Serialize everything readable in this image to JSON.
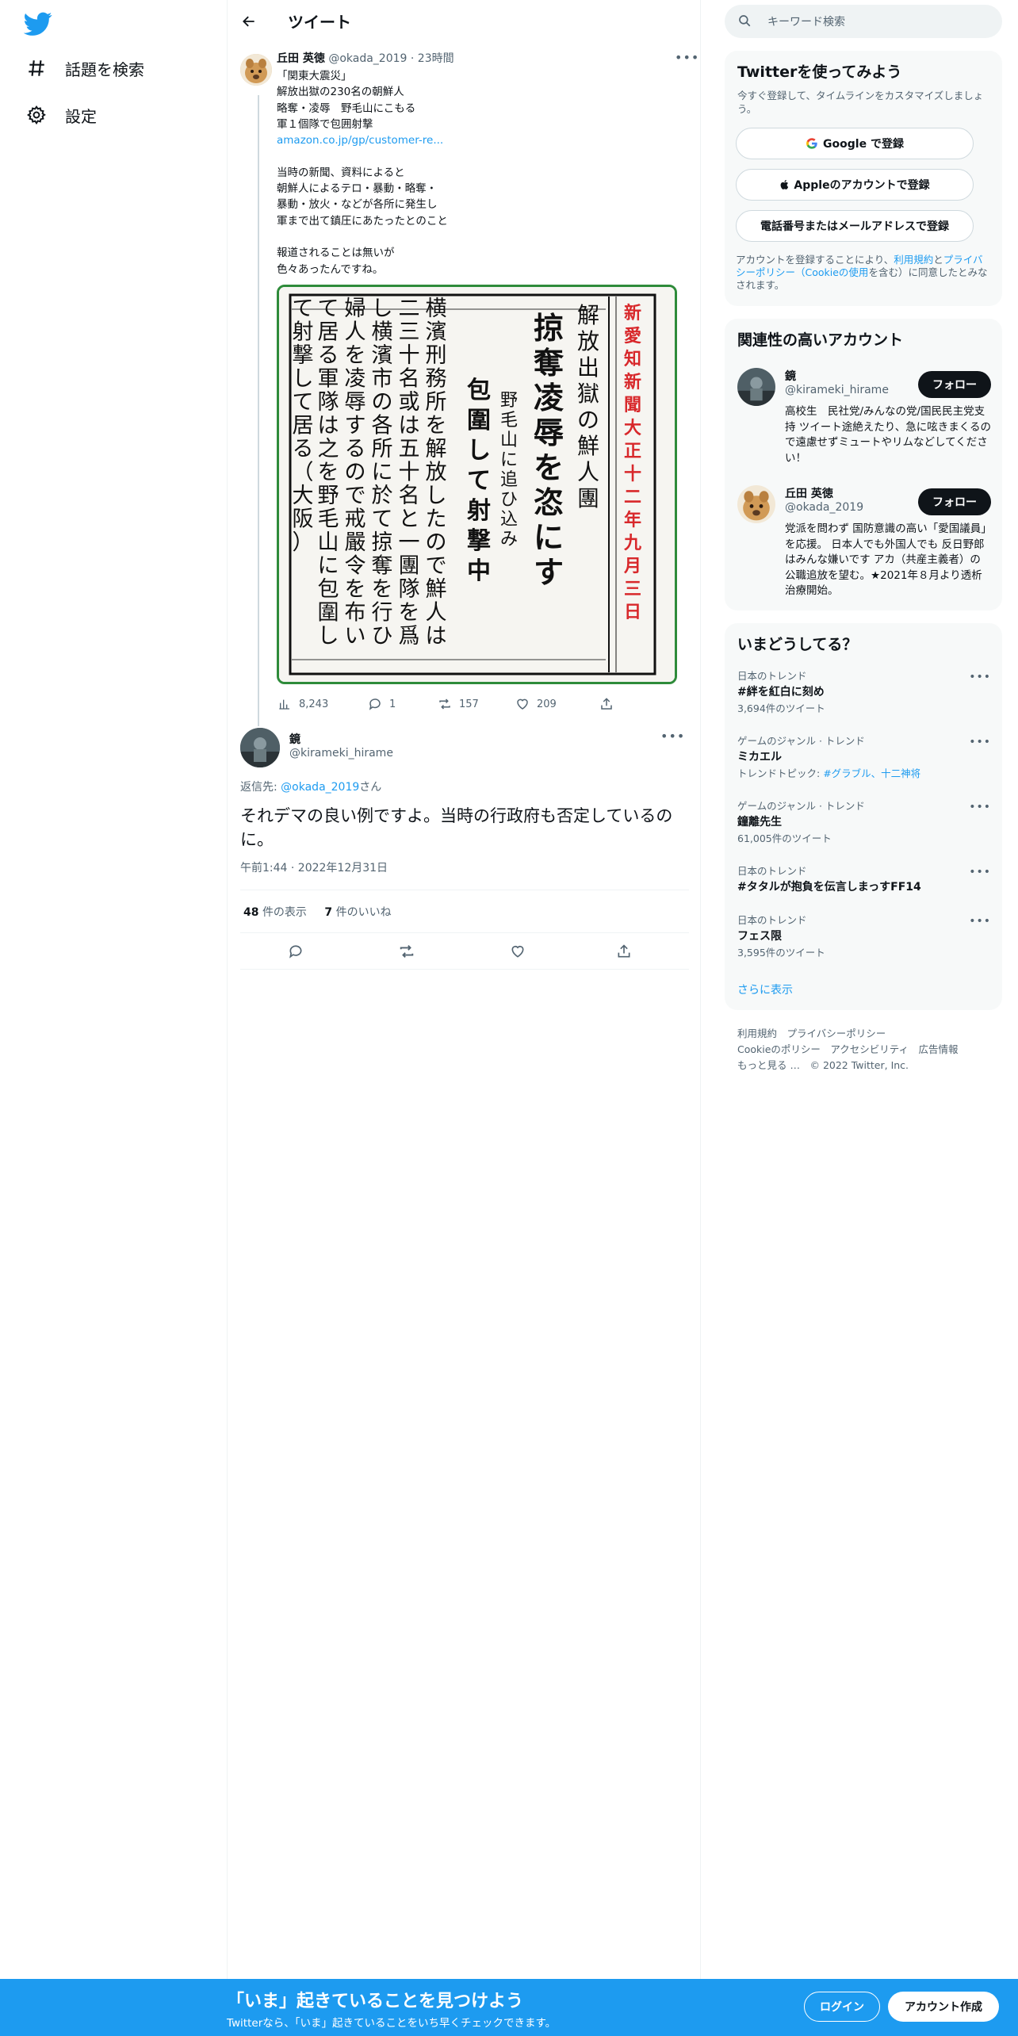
{
  "nav": {
    "explore_label": "話題を検索",
    "settings_label": "設定"
  },
  "header": {
    "title": "ツイート"
  },
  "tweet1": {
    "name": "丘田 英徳",
    "handle": "@okada_2019",
    "time": "23時間",
    "lines": [
      "「関東大震災」",
      "解放出獄の230名の朝鮮人",
      "略奪・凌辱　野毛山にこもる",
      "軍１個隊で包囲射撃"
    ],
    "link": "amazon.co.jp/gp/customer-re...",
    "lines2": [
      "当時の新聞、資料によると",
      "朝鮮人によるテロ・暴動・略奪・",
      "暴動・放火・などが各所に発生し",
      "軍まで出て鎮圧にあたったとのこと"
    ],
    "lines3": [
      "報道されることは無いが",
      "色々あったんですね。"
    ],
    "image": {
      "red_caption": "新愛知新聞 大正 十二年九月三日",
      "headline_small": "解放出獄の鮮人團",
      "headline_big": "掠奪凌辱を恣にす",
      "sub1": "野毛山に追ひ込み",
      "sub2": "包圍して射撃中",
      "body": [
        "横濱刑務所を解放したので鮮人は",
        "二三十名或は五十名と一團隊を爲",
        "し横濱市の各所に於て掠奪を行ひ",
        "婦人を凌辱するので戒嚴令を布い",
        "て居る軍隊は之を野毛山に包圍し",
        "て射撃して居る（大阪）"
      ]
    },
    "views": "8,243",
    "replies": "1",
    "retweets": "157",
    "likes": "209"
  },
  "tweet2": {
    "name": "鏡",
    "handle": "@kirameki_hirame",
    "reply_prefix": "返信先: ",
    "reply_to": "@okada_2019",
    "reply_suffix": "さん",
    "text": "それデマの良い例ですよ。当時の行政府も否定しているのに。",
    "timestamp": "午前1:44 · 2022年12月31日",
    "views_count": "48",
    "views_label": "件の表示",
    "likes_count": "7",
    "likes_label": "件のいいね"
  },
  "search": {
    "placeholder": "キーワード検索"
  },
  "signup_box": {
    "title": "Twitterを使ってみよう",
    "subtitle": "今すぐ登録して、タイムラインをカスタマイズしましょう。",
    "google": "Google で登録",
    "apple": "Appleのアカウントで登録",
    "phone": "電話番号またはメールアドレスで登録",
    "terms_1": "アカウントを登録することにより、",
    "terms_link1": "利用規約",
    "terms_2": "と",
    "terms_link2": "プライバシーポリシー（Cookieの使用",
    "terms_3": "を含む）に同意したとみなされます。"
  },
  "related": {
    "title": "関連性の高いアカウント",
    "accounts": [
      {
        "name": "鏡",
        "handle": "@kirameki_hirame",
        "bio": "高校生　民社党/みんなの党/国民民主党支持 ツイート途絶えたり、急に呟きまくるので遠慮せずミュートやリムなどしてください！",
        "follow": "フォロー"
      },
      {
        "name": "丘田 英徳",
        "handle": "@okada_2019",
        "bio": "党派を問わず 国防意識の高い「愛国議員」を応援。 日本人でも外国人でも 反日野郎はみんな嫌いです アカ（共産主義者）の公職追放を望む。★2021年８月より透析治療開始。",
        "follow": "フォロー"
      }
    ]
  },
  "trends": {
    "title": "いまどうしてる？",
    "items": [
      {
        "category": "日本のトレンド",
        "name": "#絆を紅白に刻め",
        "count": "3,694件のツイート"
      },
      {
        "category": "ゲームのジャンル · トレンド",
        "name": "ミカエル",
        "count_prefix": "トレンドトピック: ",
        "count_links": "#グラブル、十二神将"
      },
      {
        "category": "ゲームのジャンル · トレンド",
        "name": "鐘離先生",
        "count": "61,005件のツイート"
      },
      {
        "category": "日本のトレンド",
        "name": "#タタルが抱負を伝言しまっすFF14",
        "count": ""
      },
      {
        "category": "日本のトレンド",
        "name": "フェス限",
        "count": "3,595件のツイート"
      }
    ],
    "show_more": "さらに表示"
  },
  "footer": {
    "line1": "利用規約　プライバシーポリシー",
    "line2": "Cookieのポリシー　アクセシビリティ　広告情報",
    "line3": "もっと見る …　© 2022 Twitter, Inc."
  },
  "bottom_bar": {
    "title": "「いま」起きていることを見つけよう",
    "subtitle": "Twitterなら、「いま」起きていることをいち早くチェックできます。",
    "login": "ログイン",
    "signup": "アカウント作成"
  },
  "colors": {
    "accent": "#1d9bf0",
    "text": "#0f1419",
    "muted": "#536471",
    "image_border": "#2e8b3a",
    "caption_red": "#d8282b"
  }
}
